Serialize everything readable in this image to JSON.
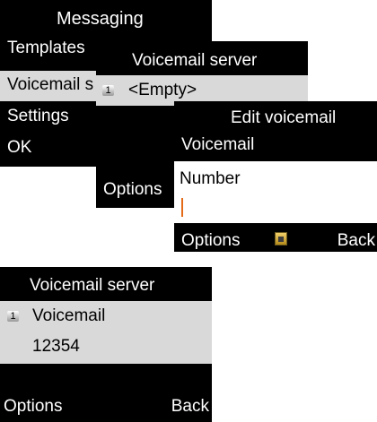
{
  "messaging_menu": {
    "title": "Messaging",
    "items": [
      "Templates",
      "Voicemail s",
      "Settings"
    ],
    "softkey_left": "OK"
  },
  "voicemail_server_popup": {
    "title": "Voicemail server",
    "entry_index": "1",
    "entry_value": "<Empty>",
    "softkey_left": "Options"
  },
  "edit_voicemail": {
    "title": "Edit voicemail",
    "name_value": "Voicemail",
    "number_label": "Number",
    "number_value": "",
    "softkey_left": "Options",
    "softkey_right": "Back",
    "center_icon": "lock-icon"
  },
  "voicemail_server_result": {
    "title": "Voicemail server",
    "entry_index": "1",
    "name": "Voicemail",
    "number": "12354",
    "softkey_left": "Options",
    "softkey_right": "Back"
  },
  "colors": {
    "screen_bg": "#000000",
    "selected_row": "#d9d9d9",
    "caret": "#e36b1a"
  }
}
